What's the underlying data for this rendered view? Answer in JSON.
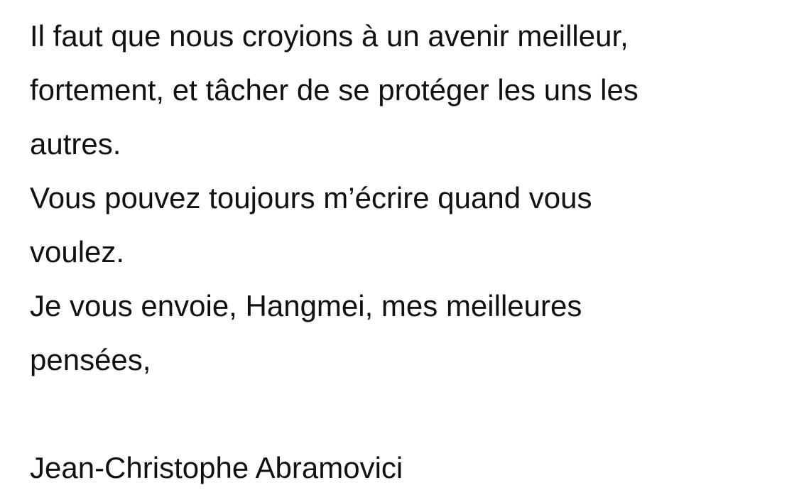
{
  "letter": {
    "lines": [
      "Il faut que nous croyions à un avenir meilleur,",
      "fortement, et tâcher de se protéger les uns les",
      "autres.",
      "Vous pouvez toujours m’écrire quand vous",
      "voulez.",
      "Je vous envoie, Hangmei, mes meilleures",
      "pensées,"
    ],
    "signature": "Jean-Christophe Abramovici"
  }
}
